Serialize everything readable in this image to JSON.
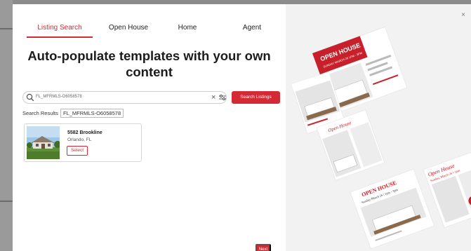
{
  "tabs": [
    {
      "label": "Listing Search",
      "active": true
    },
    {
      "label": "Open House",
      "active": false
    },
    {
      "label": "Home",
      "active": false
    },
    {
      "label": "Agent",
      "active": false
    }
  ],
  "headline": {
    "line1": "Auto-populate templates with your own",
    "line2": "content"
  },
  "search": {
    "value": "FL_MFRMLS-O6058578",
    "button_label": "Search Listings"
  },
  "results": {
    "label": "Search Results",
    "query_chip": "FL_MFRMLS-O6058578",
    "items": [
      {
        "title": "5582 Brookline",
        "location": "Orlando, FL",
        "select_label": "Select"
      }
    ]
  },
  "next_label": "Next",
  "preview_flyers": [
    {
      "heading": "OPEN HOUSE",
      "subheading": "SUNDAY MARCH 26 1PM - 3PM"
    },
    {
      "heading": "Open House",
      "subheading": "Sunday, March 26"
    },
    {
      "heading": "OPEN HOUSE",
      "subheading": "Sunday March 26 | 1pm - 3pm"
    },
    {
      "heading": "Open House",
      "subheading": "Sunday, March 26 • 1pm"
    }
  ],
  "colors": {
    "accent": "#d32a35",
    "overlay": "#8c8c8c",
    "preview_bg": "#f2f2f2"
  },
  "icons": {
    "search": "search-icon",
    "clear": "clear-icon",
    "filter": "filter-icon",
    "close": "close-icon"
  }
}
